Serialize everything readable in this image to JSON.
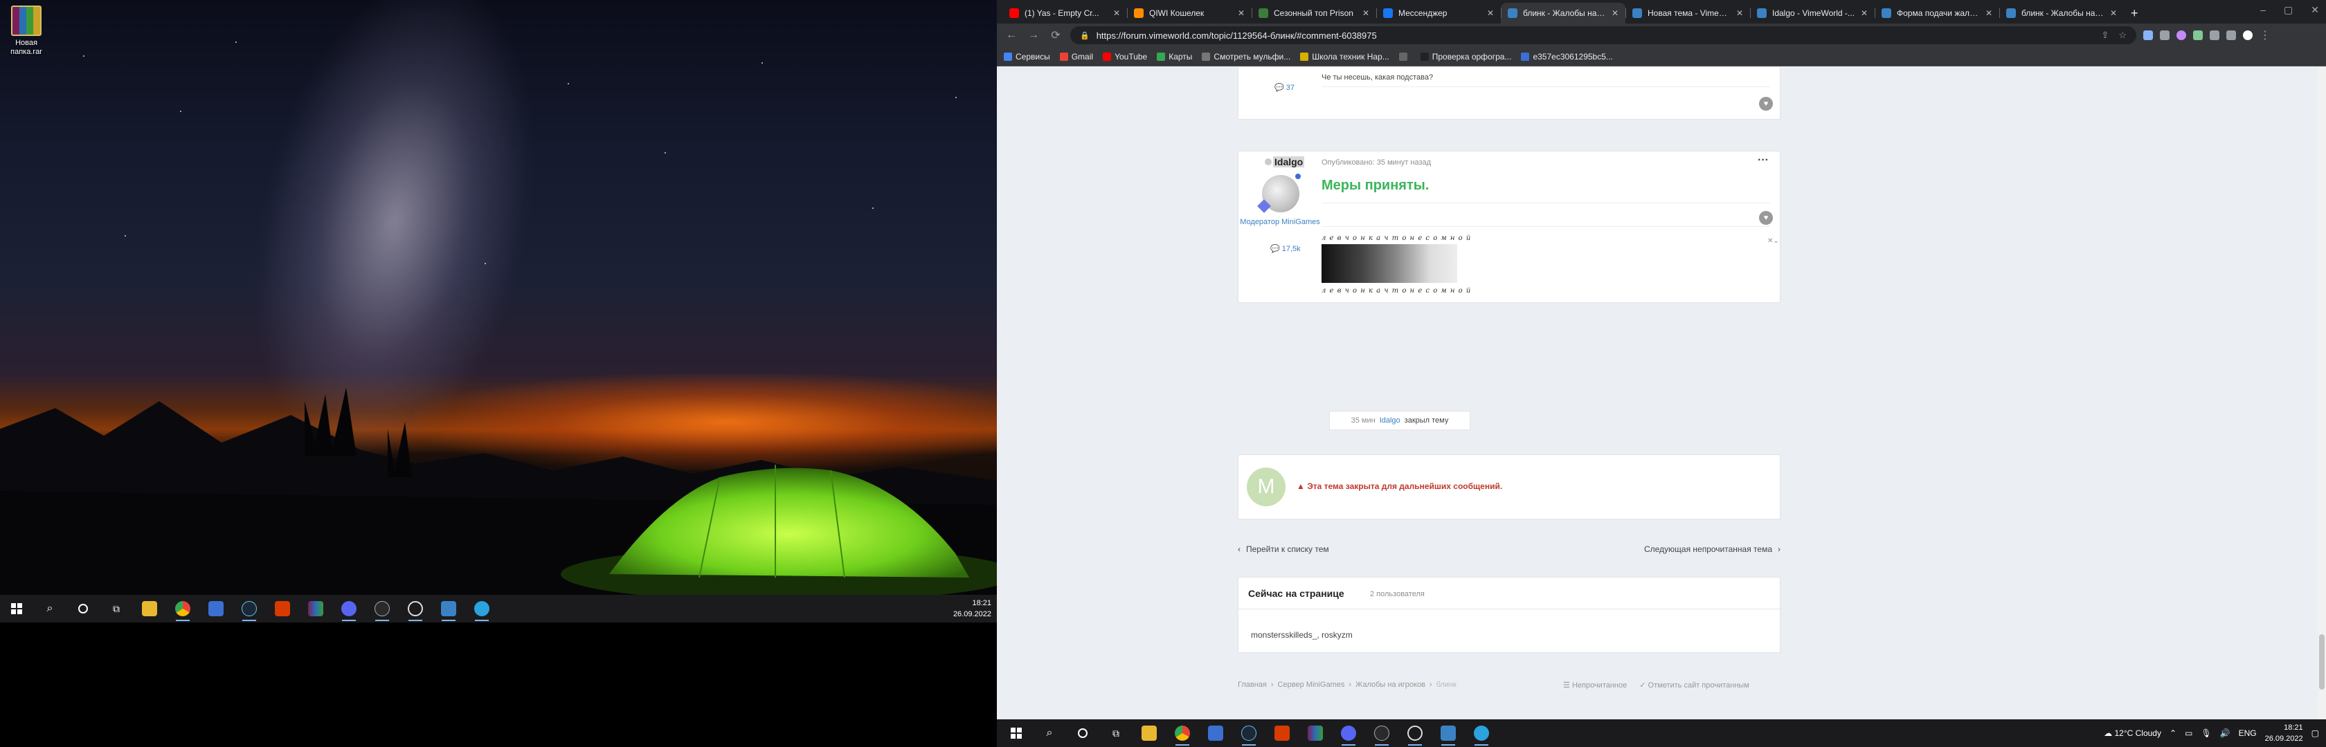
{
  "desktop": {
    "icon_label": "Новая папка.rar"
  },
  "left_taskbar": {
    "time": "18:21",
    "date": "26.09.2022",
    "apps": [
      "windows-start",
      "search",
      "cortana",
      "task-view",
      "file-explorer",
      "chrome",
      "store",
      "steam",
      "office",
      "winrar",
      "discord",
      "rockstar",
      "clock-app",
      "vimeworld",
      "telegram"
    ]
  },
  "browser": {
    "tabs": [
      {
        "title": "(1) Yas - Empty Cr...",
        "color": "#ff0000",
        "active": false
      },
      {
        "title": "QIWI Кошелек",
        "color": "#ff8c00",
        "active": false
      },
      {
        "title": "Сезонный топ Prison",
        "color": "#3a7d3a",
        "active": false
      },
      {
        "title": "Мессенджер",
        "color": "#1877f2",
        "active": false
      },
      {
        "title": "блинк - Жалобы на и...",
        "color": "#3b82c4",
        "active": true
      },
      {
        "title": "Новая тема - VimeW...",
        "color": "#3b82c4",
        "active": false
      },
      {
        "title": "Idalgo - VimeWorld -...",
        "color": "#3b82c4",
        "active": false
      },
      {
        "title": "Форма подачи жалоб...",
        "color": "#3b82c4",
        "active": false
      },
      {
        "title": "блинк - Жалобы на и...",
        "color": "#3b82c4",
        "active": false
      }
    ],
    "url": "https://forum.vimeworld.com/topic/1129564-блинк/#comment-6038975",
    "bookmarks": [
      {
        "label": "Сервисы",
        "color": "#4285f4"
      },
      {
        "label": "Gmail",
        "color": "#ea4335"
      },
      {
        "label": "YouTube",
        "color": "#ff0000"
      },
      {
        "label": "Карты",
        "color": "#34a853"
      },
      {
        "label": "Смотреть мульфи...",
        "color": "#777777"
      },
      {
        "label": "Школа техник Нар...",
        "color": "#d4b000"
      },
      {
        "label": "",
        "color": "#666666"
      },
      {
        "label": "Проверка орфогра...",
        "color": "#222222"
      },
      {
        "label": "e357ec3061295bc5...",
        "color": "#3b6fd1"
      }
    ]
  },
  "forum": {
    "prev_post": {
      "text": "Че ты несешь, какая подстава?",
      "comments": "37"
    },
    "post": {
      "author": "Idalgo",
      "role": "Модератор MiniGames",
      "posted": "Опубликовано: 35 минут назад",
      "content": "Меры приняты.",
      "comments": "17,5k",
      "signature_text": "л е в ч о н к а ч т о н е с о м н о й"
    },
    "event": {
      "time": "35 мин",
      "user": "Idalgo",
      "action": "закрыл тему"
    },
    "locked": {
      "avatar_letter": "M",
      "message": "Эта тема закрыта для дальнейших сообщений."
    },
    "nav": {
      "back": "Перейти к списку тем",
      "next": "Следующая непрочитанная тема"
    },
    "online": {
      "title": "Сейчас на странице",
      "count": "2 пользователя",
      "users": "monstersskilleds_, roskyzm"
    },
    "breadcrumb": [
      "Главная",
      "Сервер MiniGames",
      "Жалобы на игроков",
      "блинк"
    ],
    "footer_links": {
      "unread": "Непрочитанное",
      "mark_read": "Отметить сайт прочитанным"
    },
    "colors": {
      "accent_green": "#3bb55a",
      "link_blue": "#3b82c4",
      "locked_red": "#c0392b"
    }
  },
  "right_taskbar": {
    "weather": "12°C  Cloudy",
    "lang": "ENG",
    "time": "18:21",
    "date": "26.09.2022"
  }
}
